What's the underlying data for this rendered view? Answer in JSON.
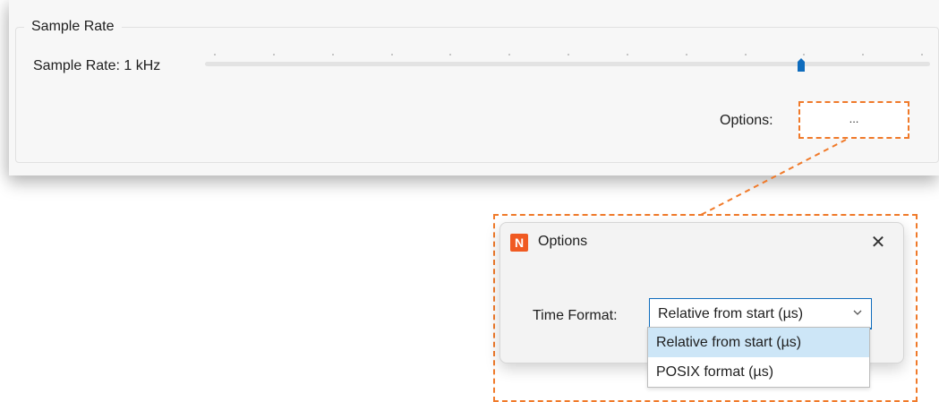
{
  "group": {
    "title": "Sample Rate"
  },
  "sample_rate": {
    "label": "Sample Rate:",
    "value": "1 kHz",
    "slider_position": 0.83,
    "tick_count": 13
  },
  "options": {
    "label": "Options:",
    "button_label": "..."
  },
  "dialog": {
    "icon_letter": "N",
    "title": "Options",
    "close_glyph": "✕",
    "time_format_label": "Time Format:",
    "time_format_value": "Relative from start (µs)",
    "time_format_options": [
      "Relative from start (µs)",
      "POSIX format (µs)"
    ]
  },
  "colors": {
    "accent": "#0f6cbd",
    "callout": "#f07a2a",
    "app_icon": "#f05a22",
    "dropdown_selected": "#cde6f7"
  }
}
